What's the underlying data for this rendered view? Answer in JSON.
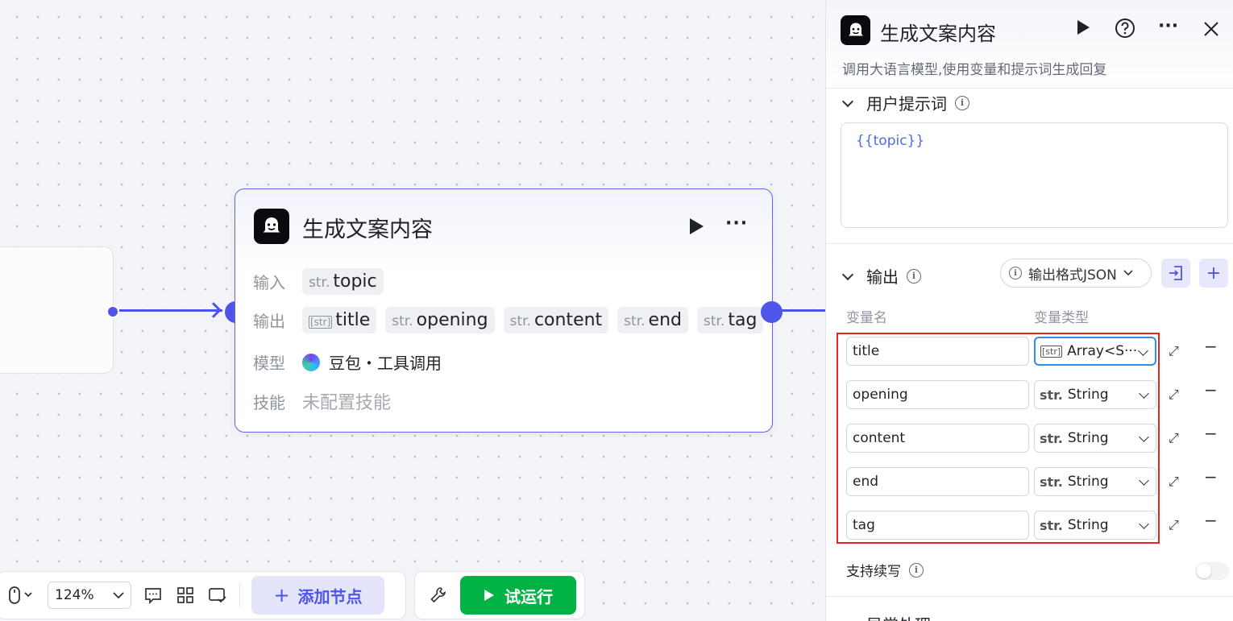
{
  "canvas": {
    "node": {
      "title": "生成文案内容",
      "input_label": "输入",
      "output_label": "输出",
      "model_label": "模型",
      "skill_label": "技能",
      "inputs": [
        {
          "type": "str.",
          "name": "topic"
        }
      ],
      "outputs": [
        {
          "type": "[str]",
          "name": "title",
          "array": true
        },
        {
          "type": "str.",
          "name": "opening",
          "array": false
        },
        {
          "type": "str.",
          "name": "content",
          "array": false
        },
        {
          "type": "str.",
          "name": "end",
          "array": false
        },
        {
          "type": "str.",
          "name": "tag",
          "array": false
        }
      ],
      "model_value": "豆包・工具调用",
      "skill_value": "未配置技能"
    }
  },
  "toolbar": {
    "zoom": "124%",
    "add_node": "添加节点",
    "test_run": "试运行"
  },
  "panel": {
    "title": "生成文案内容",
    "description": "调用大语言模型,使用变量和提示词生成回复",
    "user_prompt_title": "用户提示词",
    "user_prompt_value": "{{topic}}",
    "output_title": "输出",
    "output_format": "输出格式JSON",
    "col_var_name": "变量名",
    "col_var_type": "变量类型",
    "variables": [
      {
        "name": "title",
        "type_tag": "[str]",
        "type": "Array<S···",
        "active": true
      },
      {
        "name": "opening",
        "type_tag": "str.",
        "type": "String",
        "active": false
      },
      {
        "name": "content",
        "type_tag": "str.",
        "type": "String",
        "active": false
      },
      {
        "name": "end",
        "type_tag": "str.",
        "type": "String",
        "active": false
      },
      {
        "name": "tag",
        "type_tag": "str.",
        "type": "String",
        "active": false
      }
    ],
    "continue_write": "支持续写",
    "exception_title": "异常处理"
  },
  "colors": {
    "accent": "#4e55e8",
    "run_green": "#00b344",
    "highlight_red": "#e8261e",
    "active_border": "#2f8fe8"
  }
}
